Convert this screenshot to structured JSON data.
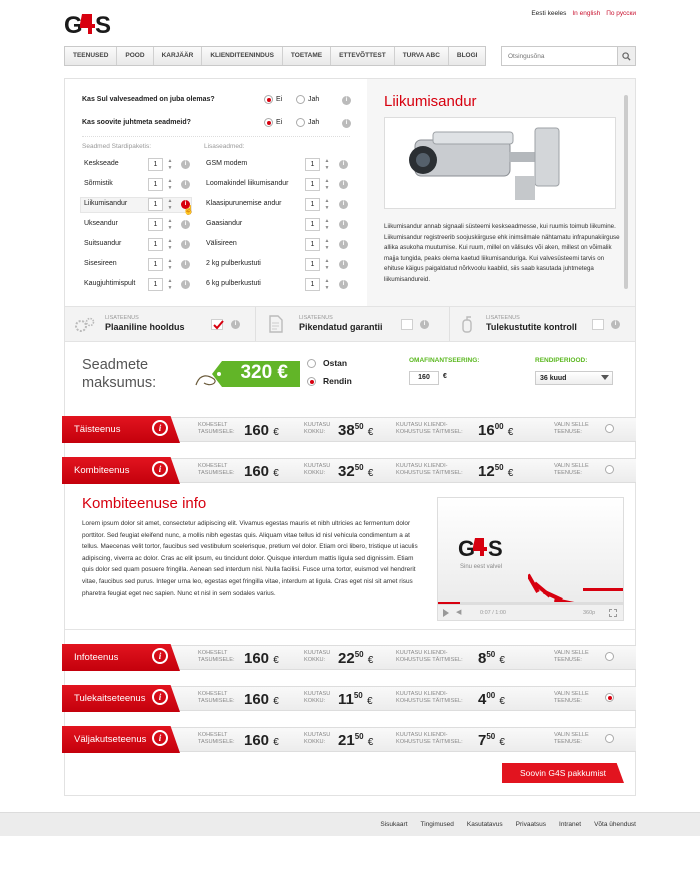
{
  "header": {
    "logo_text": "G4S",
    "languages": [
      "Eesti keeles",
      "In english",
      "По русски"
    ]
  },
  "nav": {
    "items": [
      "TEENUSED",
      "POOD",
      "KARJÄÄR",
      "KLIENDITEENINDUS",
      "TOETAME",
      "ETTEVÕTTEST",
      "TURVA ABC",
      "BLOGI"
    ]
  },
  "search": {
    "placeholder": "Otsingusõna"
  },
  "questions": [
    {
      "text": "Kas Sul valveseadmed on juba olemas?",
      "options": [
        "Ei",
        "Jah"
      ],
      "selected": "Ei"
    },
    {
      "text": "Kas soovite juhtmeta seadmeid?",
      "options": [
        "Ei",
        "Jah"
      ],
      "selected": "Ei"
    }
  ],
  "equipment": {
    "left_header": "Seadmed Stardipaketis:",
    "right_header": "Lisaseadmed:",
    "left": [
      {
        "name": "Keskseade",
        "qty": "1"
      },
      {
        "name": "Sõrmistik",
        "qty": "1"
      },
      {
        "name": "Liikumisandur",
        "qty": "1",
        "selected": true
      },
      {
        "name": "Ukseandur",
        "qty": "1"
      },
      {
        "name": "Suitsuandur",
        "qty": "1"
      },
      {
        "name": "Sisesireen",
        "qty": "1"
      },
      {
        "name": "Kaugjuhtimispult",
        "qty": "1"
      }
    ],
    "right": [
      {
        "name": "GSM modem",
        "qty": "1"
      },
      {
        "name": "Loomakindel liikumisandur",
        "qty": "1"
      },
      {
        "name": "Klaasipurunemise andur",
        "qty": "1"
      },
      {
        "name": "Gaasiandur",
        "qty": "1"
      },
      {
        "name": "Välisireen",
        "qty": "1"
      },
      {
        "name": "2 kg pulberkustuti",
        "qty": "1"
      },
      {
        "name": "6 kg pulberkustuti",
        "qty": "1"
      }
    ]
  },
  "product": {
    "title": "Liikumisandur",
    "description": "Liikumisandur annab signaali süsteemi keskseadmesse, kui ruumis toimub liikumine. Liikumisandur registreerib soojuskiirguse ehk inimsilmale nähtamatu infrapunakiirguse allika asukoha muutumise. Kui ruum, millel on välisuks või aken, millest on võimalik majja tungida, peaks olema kaetud liikumisanduriga. Kui valvesüsteemi tarvis on ehituse käigus paigaldatud nõrkvoolu kaablid, siis saab kasutada juhtmetega liikumisandureid."
  },
  "addons": [
    {
      "label": "LISATEENUS",
      "name": "Plaaniline hooldus",
      "checked": true
    },
    {
      "label": "LISATEENUS",
      "name": "Pikendatud garantii",
      "checked": false
    },
    {
      "label": "LISATEENUS",
      "name": "Tulekustutite kontroll",
      "checked": false
    }
  ],
  "cost": {
    "label_line1": "Seadmete",
    "label_line2": "maksumus:",
    "price": "320 €",
    "options": [
      "Ostan",
      "Rendin"
    ],
    "selected": "Rendin",
    "financing_label": "OMAFINANTSEERING:",
    "financing_value": "160",
    "financing_unit": "€",
    "period_label": "RENDIPERIOOD:",
    "period_value": "36 kuud"
  },
  "price_labels": {
    "now_1": "KOHESELT",
    "now_2": "TASUMISELE:",
    "total_1": "KUUTASU",
    "total_2": "KOKKU:",
    "client_1": "KUUTASU KLIENDI-",
    "client_2": "KOHUSTUSE TÄITMISEL:",
    "choose_1": "VALIN SELLE",
    "choose_2": "TEENUSE:"
  },
  "services": [
    {
      "name": "Täisteenus",
      "now": "160",
      "total_int": "38",
      "total_dec": "50",
      "client_int": "16",
      "client_dec": "00",
      "currency": "€",
      "selected": false
    },
    {
      "name": "Kombiteenus",
      "now": "160",
      "total_int": "32",
      "total_dec": "50",
      "client_int": "12",
      "client_dec": "50",
      "currency": "€",
      "selected": false
    },
    {
      "name": "Infoteenus",
      "now": "160",
      "total_int": "22",
      "total_dec": "50",
      "client_int": "8",
      "client_dec": "50",
      "currency": "€",
      "selected": false
    },
    {
      "name": "Tulekaitseteenus",
      "now": "160",
      "total_int": "11",
      "total_dec": "50",
      "client_int": "4",
      "client_dec": "00",
      "currency": "€",
      "selected": true
    },
    {
      "name": "Väljakutseteenus",
      "now": "160",
      "total_int": "21",
      "total_dec": "50",
      "client_int": "7",
      "client_dec": "50",
      "currency": "€",
      "selected": false
    }
  ],
  "combi_info": {
    "title": "Kombiteenuse info",
    "text": "Lorem ipsum dolor sit amet, consectetur adipiscing elit. Vivamus egestas mauris et nibh ultricies ac fermentum dolor porttitor. Sed feugiat eleifend nunc, a mollis nibh egestas quis. Aliquam vitae tellus id nisl vehicula condimentum a at tellus. Maecenas velit tortor, faucibus sed vestibulum scelerisque, pretium vel dolor. Etiam orci libero, tristique ut iaculis adipiscing, viverra ac dolor. Cras ac elit ipsum, eu tincidunt dolor. Quisque interdum mattis ligula sed dignissim. Etiam quis dolor sed quam posuere fringilla. Aenean sed interdum nisl. Nulla facilisi. Fusce urna tortor, euismod vel hendrerit vitae, faucibus sed purus. Integer urna leo, egestas eget fringilla vitae, interdum at ligula. Cras eget nisl sit amet risus pharetra feugiat eget nec sapien. Nunc et nisl in sem sodales varius.",
    "video_logo": "G4S",
    "video_tagline": "Sinu eest valvel",
    "video_time": "0:07 / 1:00",
    "video_quality": "360p"
  },
  "cta": {
    "label": "Soovin G4S pakkumist"
  },
  "footer": {
    "links": [
      "Sisukaart",
      "Tingimused",
      "Kasutatavus",
      "Privaatsus",
      "Intranet",
      "Võta ühendust"
    ]
  },
  "colors": {
    "brand_red": "#d7000f",
    "accent_green": "#5bb820"
  }
}
